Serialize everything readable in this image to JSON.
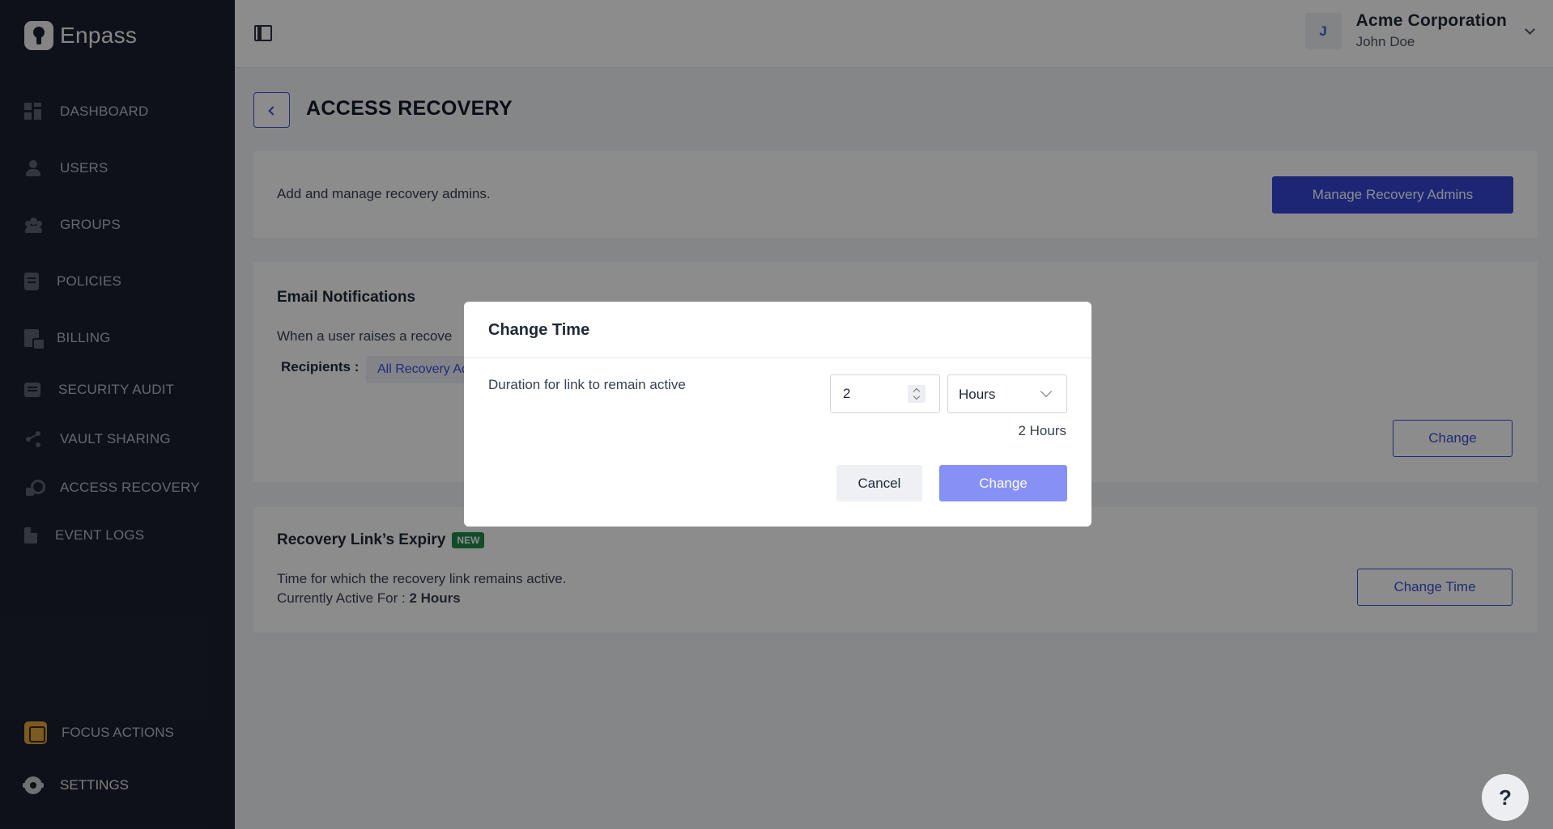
{
  "app": {
    "name": "Enpass"
  },
  "sidebar": {
    "items": [
      {
        "label": "DASHBOARD",
        "icon": "dashboard-icon"
      },
      {
        "label": "USERS",
        "icon": "user-icon"
      },
      {
        "label": "GROUPS",
        "icon": "group-icon"
      },
      {
        "label": "POLICIES",
        "icon": "policy-icon"
      },
      {
        "label": "BILLING",
        "icon": "billing-icon"
      },
      {
        "label": "SECURITY AUDIT",
        "icon": "audit-icon"
      },
      {
        "label": "VAULT SHARING",
        "icon": "share-icon"
      },
      {
        "label": "ACCESS RECOVERY",
        "icon": "key-icon"
      },
      {
        "label": "EVENT LOGS",
        "icon": "log-icon"
      }
    ],
    "focus_actions": "FOCUS ACTIONS",
    "settings": "SETTINGS"
  },
  "header": {
    "avatar_initial": "J",
    "org_name": "Acme Corporation",
    "user_name": "John Doe"
  },
  "page": {
    "title": "ACCESS RECOVERY",
    "admins": {
      "description": "Add and manage recovery admins.",
      "button": "Manage Recovery Admins"
    },
    "email": {
      "heading": "Email Notifications",
      "description": "When a user raises a recove",
      "recipients_label": "Recipients :",
      "recipient_chip": "All Recovery Ad",
      "button": "Change"
    },
    "expiry": {
      "heading": "Recovery Link’s Expiry",
      "badge": "NEW",
      "description": "Time for which the recovery link remains active.",
      "current_label": "Currently Active For :",
      "current_value": "2 Hours",
      "button": "Change Time"
    }
  },
  "modal": {
    "title": "Change Time",
    "label": "Duration for link to remain active",
    "duration_value": "2",
    "unit_value": "Hours",
    "summary": "2 Hours",
    "cancel": "Cancel",
    "confirm": "Change"
  },
  "help": "?",
  "colors": {
    "sidebar_bg": "#1c2030",
    "primary": "#3446d6",
    "primary_disabled": "#8791f5",
    "badge_green": "#1f8a4c",
    "focus_orange": "#e0a63a"
  }
}
